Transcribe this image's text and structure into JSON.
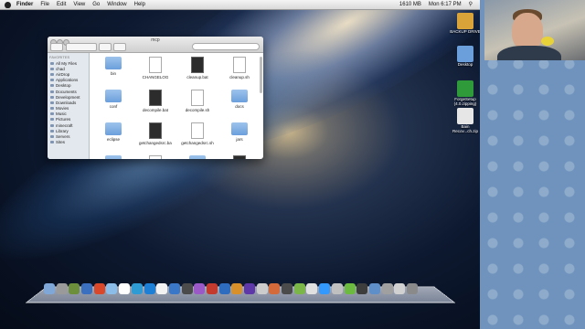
{
  "menubar": {
    "app_name": "Finder",
    "menus": [
      "File",
      "Edit",
      "View",
      "Go",
      "Window",
      "Help"
    ],
    "status": {
      "memory": "1610 MB",
      "datetime": "Mon 6:17 PM"
    }
  },
  "finder": {
    "title": "mcp",
    "sidebar_heading": "FAVORITES",
    "sidebar_items": [
      "All My Files",
      "chad",
      "AirDrop",
      "Applications",
      "Desktop",
      "Documents",
      "Development",
      "Downloads",
      "Movies",
      "Music",
      "Pictures",
      "minecraft",
      "Library",
      "Servers",
      "Sites"
    ],
    "files": [
      {
        "name": "bin",
        "kind": "folder"
      },
      {
        "name": "CHANGELOG",
        "kind": "doc"
      },
      {
        "name": "cleanup.bat",
        "kind": "bat"
      },
      {
        "name": "cleanup.sh",
        "kind": "doc"
      },
      {
        "name": "conf",
        "kind": "folder"
      },
      {
        "name": "decompile.bat",
        "kind": "bat"
      },
      {
        "name": "decompile.sh",
        "kind": "doc"
      },
      {
        "name": "docs",
        "kind": "folder"
      },
      {
        "name": "eclipse",
        "kind": "folder"
      },
      {
        "name": "getchangedsrc.bat",
        "kind": "bat"
      },
      {
        "name": "getchangedsrc.sh",
        "kind": "doc"
      },
      {
        "name": "jars",
        "kind": "folder"
      },
      {
        "name": "",
        "kind": "folder"
      },
      {
        "name": "",
        "kind": "doc"
      },
      {
        "name": "",
        "kind": "folder"
      },
      {
        "name": "",
        "kind": "bat"
      }
    ]
  },
  "desktop_icons": [
    {
      "label": "BACKUP DRIVE",
      "icon": "drive-icon"
    },
    {
      "label": "Desktop",
      "icon": "folder-icon"
    },
    {
      "label": "ForgeSetup (4.0.zipping)",
      "icon": "archive-icon"
    },
    {
      "label": "Bain Recov...ch.zip",
      "icon": "zip-icon"
    }
  ],
  "dock": {
    "colors": [
      "#7fa7d8",
      "#9a9a9a",
      "#6d8e3b",
      "#3b6fbf",
      "#d9482b",
      "#8cbce8",
      "#ffffff",
      "#2f9bd4",
      "#1d7fd6",
      "#f2f2f2",
      "#3a77c9",
      "#4b4b4b",
      "#9a59c7",
      "#c43b2e",
      "#2e6cc0",
      "#d8902b",
      "#5e37a8",
      "#cccccc",
      "#d46a3a",
      "#4b4b4b",
      "#7ab648",
      "#e0e0e0",
      "#3399ff",
      "#c0c0c0",
      "#6cba3f",
      "#3d3d3d",
      "#5f8fc9",
      "#a0a0a0",
      "#d1d1d1",
      "#8a8a8a"
    ]
  }
}
